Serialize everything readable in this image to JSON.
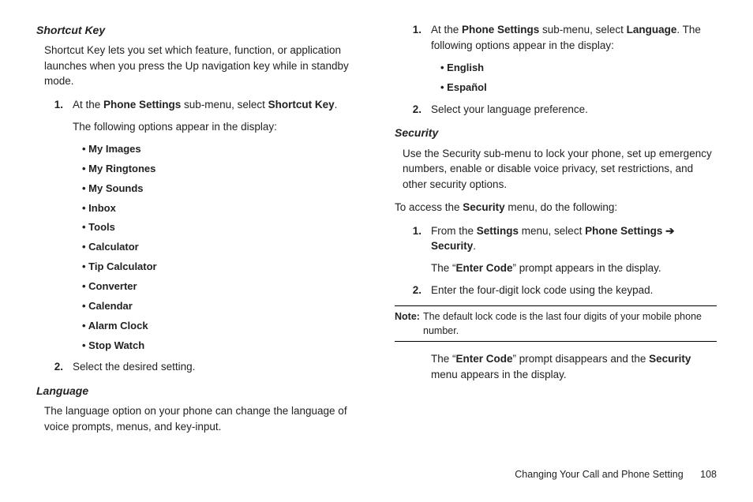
{
  "left": {
    "shortcut": {
      "heading": "Shortcut Key",
      "intro": "Shortcut Key lets you set which feature, function, or application launches when you press the Up navigation key while in standby mode.",
      "step1_num": "1.",
      "step1_a": "At the ",
      "step1_b": "Phone Settings",
      "step1_c": " sub-menu, select ",
      "step1_d": "Shortcut Key",
      "step1_e": ".",
      "step1_para2": "The following options appear in the display:",
      "options": [
        "My Images",
        "My Ringtones",
        "My Sounds",
        "Inbox",
        "Tools",
        "Calculator",
        "Tip Calculator",
        "Converter",
        "Calendar",
        "Alarm Clock",
        "Stop Watch"
      ],
      "step2_num": "2.",
      "step2": "Select the desired setting."
    },
    "language": {
      "heading": "Language",
      "intro": "The language option on your phone can change the language of voice prompts, menus, and key-input."
    }
  },
  "right": {
    "lang": {
      "step1_num": "1.",
      "step1_a": "At the ",
      "step1_b": "Phone Settings",
      "step1_c": " sub-menu, select ",
      "step1_d": "Language",
      "step1_e": ". The following options appear in the display:",
      "options": [
        "English",
        "Español"
      ],
      "step2_num": "2.",
      "step2": "Select your language preference."
    },
    "security": {
      "heading": "Security",
      "intro": "Use the Security sub-menu to lock your phone, set up emergency numbers, enable or disable voice privacy, set restrictions, and other security options.",
      "accessline_a": "To access the ",
      "accessline_b": "Security",
      "accessline_c": " menu, do the following:",
      "step1_num": "1.",
      "step1_a": "From the ",
      "step1_b": "Settings",
      "step1_c": " menu, select ",
      "step1_d": "Phone Settings",
      "step1_arrow": " ➔ ",
      "step1_e": "Security",
      "step1_f": ".",
      "step1_p2_a": "The “",
      "step1_p2_b": "Enter Code",
      "step1_p2_c": "” prompt appears in the display.",
      "step2_num": "2.",
      "step2": "Enter the four-digit lock code using the keypad.",
      "note_label": "Note:",
      "note_text": "The default lock code is the last four digits of your mobile phone number.",
      "after_a": "The “",
      "after_b": "Enter Code",
      "after_c": "” prompt disappears and the ",
      "after_d": "Security",
      "after_e": " menu appears in the display."
    }
  },
  "footer": {
    "title": "Changing Your Call and Phone Setting",
    "page": "108"
  }
}
